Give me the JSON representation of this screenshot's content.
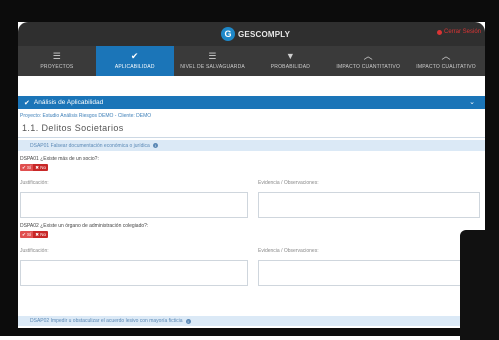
{
  "app": {
    "logo_text": "GESCOMPLY",
    "logout_label": "Cerrar Sesión"
  },
  "nav": [
    {
      "label": "PROYECTOS",
      "icon": "list-icon",
      "glyph": "☰",
      "active": false
    },
    {
      "label": "APLICABILIDAD",
      "icon": "check-icon",
      "glyph": "✔",
      "active": true
    },
    {
      "label": "NIVEL DE SALVAGUARDA",
      "icon": "bars-icon",
      "glyph": "☰",
      "active": false
    },
    {
      "label": "PROBABILIDAD",
      "icon": "filter-icon",
      "glyph": "▼",
      "active": false
    },
    {
      "label": "IMPACTO CUANTITATIVO",
      "icon": "up-icon",
      "glyph": "︿",
      "active": false
    },
    {
      "label": "IMPACTO CUALITATIVO",
      "icon": "up-icon",
      "glyph": "︿",
      "active": false
    }
  ],
  "section": {
    "title": "Análisis de Aplicabilidad",
    "project": "Proyecto: Estudio Análisis Riesgos DEMO - Cliente: DEMO",
    "heading": "1.1. Delitos Societarios"
  },
  "groups": {
    "first": "DSAP01 Falsear documentación económica o jurídica",
    "second": "DSAP02 Impedir u obstaculizar el acuerdo lesivo con mayoría ficticia"
  },
  "questions": [
    {
      "text": "DSPA01 ¿Existe más de un socio?:",
      "yes": "✔ Sí",
      "no": "✖ No",
      "justification_label": "Justificación:",
      "evidence_label": "Evidencia / Observaciones:"
    },
    {
      "text": "DSPA02 ¿Existe un órgano de administración colegiado?:",
      "yes": "✔ Sí",
      "no": "✖ No",
      "justification_label": "Justificación:",
      "evidence_label": "Evidencia / Observaciones:"
    }
  ],
  "colors": {
    "accent": "#1b75b8",
    "header": "#2f2f2f",
    "nav": "#3a3a3a",
    "danger": "#d93434"
  }
}
